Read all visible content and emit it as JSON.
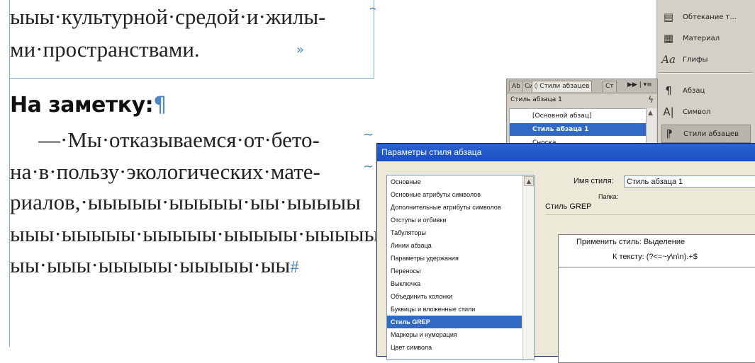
{
  "document": {
    "line1": "ыыы·культурной·средой·и·жилы-",
    "line2": "ми·пространствами.",
    "heading": "На заметку:",
    "pilcrow": "¶",
    "body_lines": [
      "—·Мы·отказываемся·от·бето-",
      "на·в·пользу·экологических·мате-",
      "риалов,·ыыыыы·ыыыыы·ыы·ыыыыы",
      "ыыы·ыыыыы·ыыыыы·ыыыыы·ыыыыы",
      "ыы·ыыы·ыыыыы·ыыыыы·ыы"
    ],
    "end_mark": "#"
  },
  "tools_panel": {
    "items": [
      {
        "label": "Обтекание т...",
        "icon": "text-wrap-icon",
        "glyph": "▤"
      },
      {
        "label": "Материал",
        "icon": "story-icon",
        "glyph": "▦"
      },
      {
        "label": "Глифы",
        "icon": "glyphs-icon",
        "glyph": "Aa"
      },
      {
        "label": "Абзац",
        "icon": "paragraph-icon",
        "glyph": "¶"
      },
      {
        "label": "Символ",
        "icon": "character-icon",
        "glyph": "A|"
      },
      {
        "label": "Стили абзацев",
        "icon": "paragraph-styles-icon",
        "glyph": "⁋"
      }
    ],
    "selected_index": 5
  },
  "paragraph_styles_palette": {
    "tabs": [
      "Ab",
      "Си",
      "◊ Стили абзацев",
      "Ст"
    ],
    "active_tab": 2,
    "menu_glyph": "▶▶ | ▾≡",
    "current_style": "Стиль абзаца 1",
    "lightning": "ϟ",
    "styles": [
      "[Основной абзац]",
      "Стиль абзаца 1",
      "Сноска"
    ],
    "selected_style": 1
  },
  "dialog": {
    "title": "Параметры стиля абзаца",
    "categories": [
      "Основные",
      "Основные атрибуты символов",
      "Дополнительные атрибуты символов",
      "Отступы и отбивки",
      "Табуляторы",
      "Линии абзаца",
      "Параметры удержания",
      "Переносы",
      "Выключка",
      "Объединить колонки",
      "Буквицы и вложенные стили",
      "Стиль GREP",
      "Маркеры и нумерация",
      "Цвет символа"
    ],
    "selected_category": 11,
    "style_name_label": "Имя стиля:",
    "style_name_value": "Стиль абзаца 1",
    "folder_label": "Папка:",
    "section_title": "Стиль GREP",
    "grep_apply": "Применить стиль: Выделение",
    "grep_to_text": "К тексту: (?<=~y\\n\\n).+$",
    "scroll_up_glyph": "▲"
  }
}
